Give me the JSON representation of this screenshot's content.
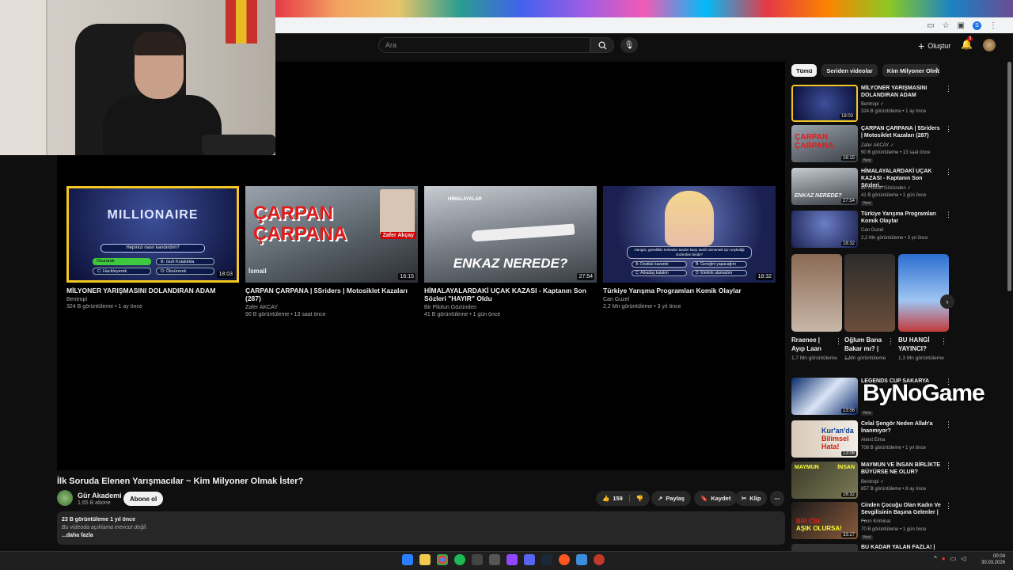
{
  "browser": {
    "icons": [
      "cast-icon",
      "star-icon",
      "extension-icon",
      "profile-icon"
    ],
    "profile_initial": "S"
  },
  "header": {
    "search_placeholder": "Ara",
    "create_label": "Oluştur",
    "notification_count": "3"
  },
  "endscreen": [
    {
      "title": "MİLYONER YARIŞMASINI DOLANDIRAN ADAM",
      "channel": "Bentropi",
      "meta": "324 B görüntüleme • 1 ay önce",
      "duration": "18:03",
      "thumb_text": "MILLIONAIRE",
      "q": "Hepinizi nasıl kandırdım?",
      "a": "Osurarak",
      "b": "B: Gizli Kulaklıkla",
      "c": "C: Hackleyerek",
      "d": "D: Öksürerek"
    },
    {
      "title": "ÇARPAN ÇARPANA | 5Sriders | Motosiklet Kazaları (287)",
      "channel": "Zafer AKCAY",
      "meta": "90 B görüntüleme • 13 saat önce",
      "duration": "16:15",
      "thumb_text": "ÇARPAN ÇARPANA",
      "overlay": "Zafer Akçay",
      "bottom": "İsmail"
    },
    {
      "title": "HİMALAYALARDAKİ UÇAK KAZASI - Kaptanın Son Sözleri \"HAYIR\" Oldu",
      "channel": "Bir Pilotun Gözünden",
      "meta": "41 B görüntüleme • 1 gün önce",
      "duration": "27:54",
      "thumb_text": "ENKAZ NEREDE?",
      "tag": "HİMALAYALAR"
    },
    {
      "title": "Türkiye Yarışma Programları Komik Olaylar",
      "channel": "Can Guzel",
      "meta": "2,2 Mn görüntüleme • 3 yıl önce",
      "duration": "18:32",
      "q": "Hangisi, genellikle terkeden tarafın karşı tarafı üzmemek için söylediği sözlerden biridir?",
      "a": "A: Dostluk kazandı",
      "b": "B: Gereğini yapacağım",
      "c": "C: Arkadaş kalalım",
      "d": "D: Elektrik alamadım"
    }
  ],
  "video": {
    "title": "İlk Soruda Elenen Yarışmacılar ~ Kim Milyoner Olmak İster?",
    "channel": "Gür Akademi",
    "subs": "1,65 B abone",
    "subscribe_label": "Abone ol",
    "likes": "159",
    "share_label": "Paylaş",
    "save_label": "Kaydet",
    "clip_label": "Klip",
    "desc_views": "23 B görüntüleme  1 yıl önce",
    "desc_text": "Bu videoda açıklama mevcut değil.",
    "desc_more": "...daha fazla"
  },
  "chips": [
    "Tümü",
    "Seriden videolar",
    "Kim Milyoner Olmak İster"
  ],
  "recommendations": [
    {
      "title": "MİLYONER YARIŞMASINI DOLANDIRAN ADAM",
      "channel": "Bentropi ✓",
      "meta": "324 B görüntüleme • 1 ay önce",
      "duration": "18:03",
      "new": ""
    },
    {
      "title": "ÇARPAN ÇARPANA | 5Sriders | Motosiklet Kazaları (287)",
      "channel": "Zafer AKCAY ✓",
      "meta": "90 B görüntüleme • 13 saat önce",
      "duration": "16:15",
      "new": "Yeni"
    },
    {
      "title": "HİMALAYALARDAKİ UÇAK KAZASI - Kaptanın Son Sözleri...",
      "channel": "Bir Pilotun Gözünden ✓",
      "meta": "41 B görüntüleme • 1 gün önce",
      "duration": "27:54",
      "new": "Yeni"
    },
    {
      "title": "Türkiye Yarışma Programları Komik Olaylar",
      "channel": "Can Guzel",
      "meta": "2,2 Mn görüntüleme • 3 yıl önce",
      "duration": "18:32",
      "new": ""
    }
  ],
  "shorts": [
    {
      "title": "Rraenee | Ayıp Laan",
      "views": "1,7 Mn görüntüleme"
    },
    {
      "title": "Oğlum Bana Bakar mı? | ...",
      "views": "1 Mn görüntüleme"
    },
    {
      "title": "BU HANGİ YAYINCI?",
      "views": "1,3 Mn görüntüleme"
    }
  ],
  "recommendations2": [
    {
      "title": "LEGENDS CUP SAKARYA",
      "channel": "",
      "meta": "",
      "duration": "13:56",
      "new": "Yeni"
    },
    {
      "title": "Celal Şengör Neden Allah'a İnanmıyor?",
      "channel": "Ateist Elma",
      "meta": "708 B görüntüleme • 1 yıl önce",
      "duration": "13:06",
      "new": ""
    },
    {
      "title": "MAYMUN VE İNSAN BİRLİKTE BÜYÜRSE NE OLUR?",
      "channel": "Bentropi ✓",
      "meta": "857 B görüntüleme • 8 ay önce",
      "duration": "16:32",
      "new": ""
    },
    {
      "title": "Cinden Çocuğu Olan Kadın Ve Sevgilisinin Başına Gelenler | ...",
      "channel": "Foon Kriminal",
      "meta": "70 B görüntüleme • 1 gün önce",
      "duration": "33:27",
      "new": "Yeni"
    },
    {
      "title": "BU KADAR YALAN FAZLA! |",
      "channel": "",
      "meta": "",
      "duration": "",
      "new": ""
    }
  ],
  "watermark": "ByNoGame",
  "taskbar": {
    "time": "00:04",
    "date": "30.03.2026"
  }
}
